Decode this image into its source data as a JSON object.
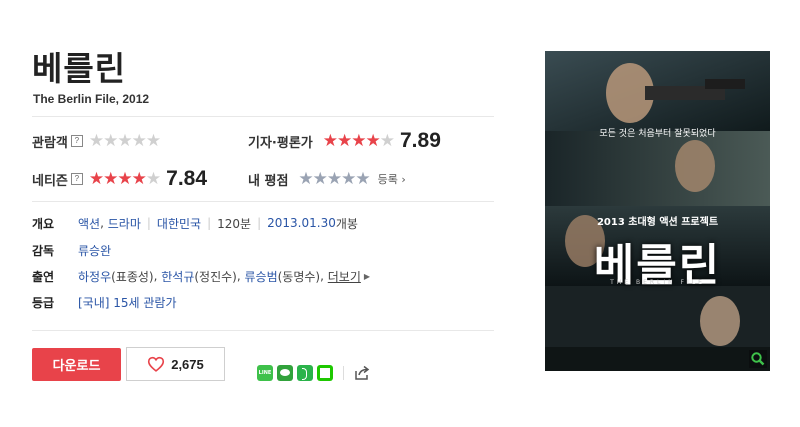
{
  "movie": {
    "title": "베를린",
    "subtitle": "The Berlin File, 2012"
  },
  "ratings": {
    "audience": {
      "label": "관람객",
      "help": "?",
      "stars_filled": 0,
      "stars_total": 5
    },
    "critic": {
      "label": "기자·평론가",
      "stars_filled": 4,
      "stars_total": 5,
      "score": "7.89"
    },
    "netizen": {
      "label": "네티즌",
      "help": "?",
      "stars_filled": 4,
      "stars_total": 5,
      "score": "7.84"
    },
    "my": {
      "label": "내 평점",
      "stars_total": 5,
      "register": "등록"
    }
  },
  "info": {
    "overview": {
      "label": "개요",
      "genres": [
        "액션",
        "드라마"
      ],
      "country": "대한민국",
      "runtime": "120분",
      "release": "2013.01.30",
      "release_suffix": "개봉"
    },
    "director": {
      "label": "감독",
      "name": "류승완"
    },
    "cast": {
      "label": "출연",
      "actors": [
        {
          "name": "하정우",
          "role": "(표종성)"
        },
        {
          "name": "한석규",
          "role": "(정진수)"
        },
        {
          "name": "류승범",
          "role": "(동명수)"
        }
      ],
      "more": "더보기"
    },
    "grade": {
      "label": "등급",
      "value": "[국내] 15세 관람가"
    }
  },
  "actions": {
    "download": "다운로드",
    "like_count": "2,675",
    "share_icons": [
      "line-icon",
      "kakaotalk-icon",
      "band-icon",
      "cafe-icon",
      "share-icon"
    ]
  },
  "poster": {
    "top_text": "모든 것은 처음부터 잘못되었다",
    "badge": "2013 초대형 액션 프로젝트",
    "title": "베를린",
    "subtitle": "THE BERLIN FILE"
  },
  "colors": {
    "accent": "#e8434a",
    "link": "#2a55a6",
    "star_off": "#d0d0d0",
    "user_star": "#9aa3b3"
  }
}
